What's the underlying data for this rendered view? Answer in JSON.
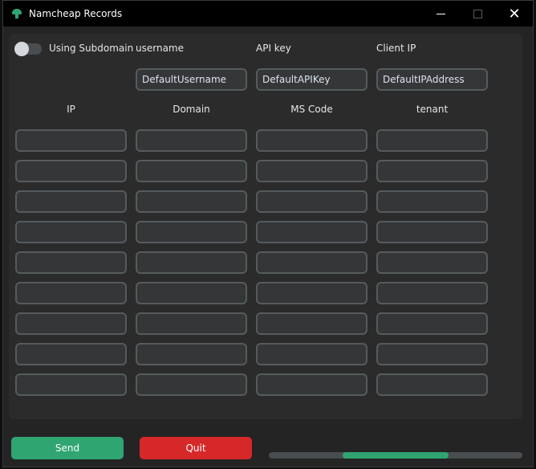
{
  "window": {
    "title": "Namcheap Records"
  },
  "controls": {
    "minimize": "",
    "maximize": "",
    "close": "✕"
  },
  "subdomain_toggle": {
    "label": "Using Subdomain",
    "on": false
  },
  "credentials": [
    {
      "label": "username",
      "value": "DefaultUsername"
    },
    {
      "label": "API key",
      "value": "DefaultAPIKey"
    },
    {
      "label": "Client IP",
      "value": "DefaultIPAddress"
    }
  ],
  "columns": [
    "IP",
    "Domain",
    "MS Code",
    "tenant"
  ],
  "rows": [
    [
      "",
      "",
      "",
      ""
    ],
    [
      "",
      "",
      "",
      ""
    ],
    [
      "",
      "",
      "",
      ""
    ],
    [
      "",
      "",
      "",
      ""
    ],
    [
      "",
      "",
      "",
      ""
    ],
    [
      "",
      "",
      "",
      ""
    ],
    [
      "",
      "",
      "",
      ""
    ],
    [
      "",
      "",
      "",
      ""
    ],
    [
      "",
      "",
      "",
      ""
    ]
  ],
  "buttons": {
    "send": "Send",
    "quit": "Quit"
  },
  "progress": {
    "start": 0.29,
    "end": 0.71
  },
  "colors": {
    "accent": "#2fa572",
    "danger": "#d62828",
    "field_bg": "#343638",
    "field_border": "#565b5e"
  }
}
